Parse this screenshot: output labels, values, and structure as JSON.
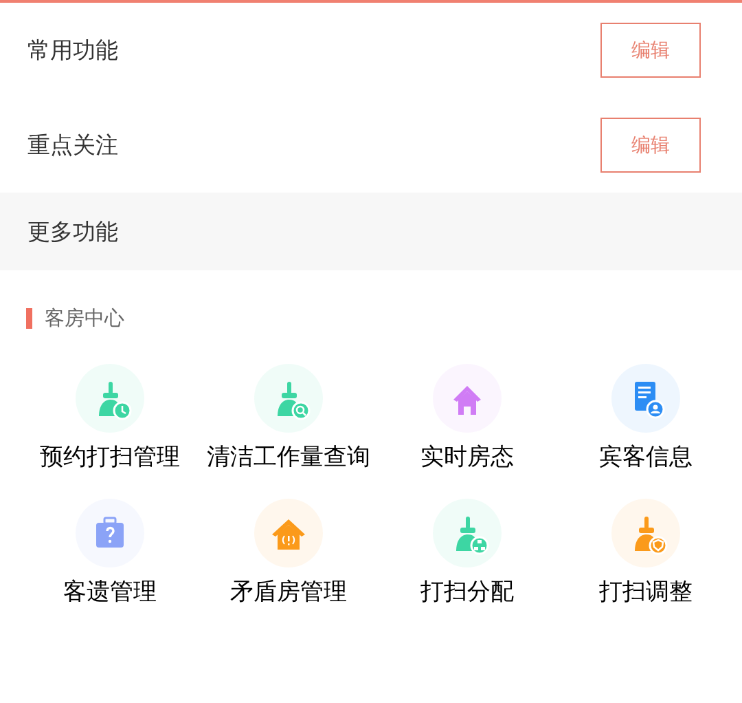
{
  "sections": [
    {
      "title": "常用功能",
      "button": "编辑"
    },
    {
      "title": "重点关注",
      "button": "编辑"
    }
  ],
  "more": {
    "title": "更多功能"
  },
  "category": {
    "title": "客房中心"
  },
  "items": [
    {
      "label": "预约打扫管理",
      "kind": "clock",
      "color": "#3dd6a3"
    },
    {
      "label": "清洁工作量查询",
      "kind": "search",
      "color": "#3dd6a3"
    },
    {
      "label": "实时房态",
      "kind": "home",
      "color": "#d07cf5"
    },
    {
      "label": "宾客信息",
      "kind": "guest",
      "color": "#2c8df4"
    },
    {
      "label": "客遗管理",
      "kind": "lost",
      "color": "#8ba3f7"
    },
    {
      "label": "矛盾房管理",
      "kind": "conflict",
      "color": "#fb9a1a"
    },
    {
      "label": "打扫分配",
      "kind": "assign",
      "color": "#3dd6a3"
    },
    {
      "label": "打扫调整",
      "kind": "adjust",
      "color": "#fb9a1a"
    }
  ]
}
